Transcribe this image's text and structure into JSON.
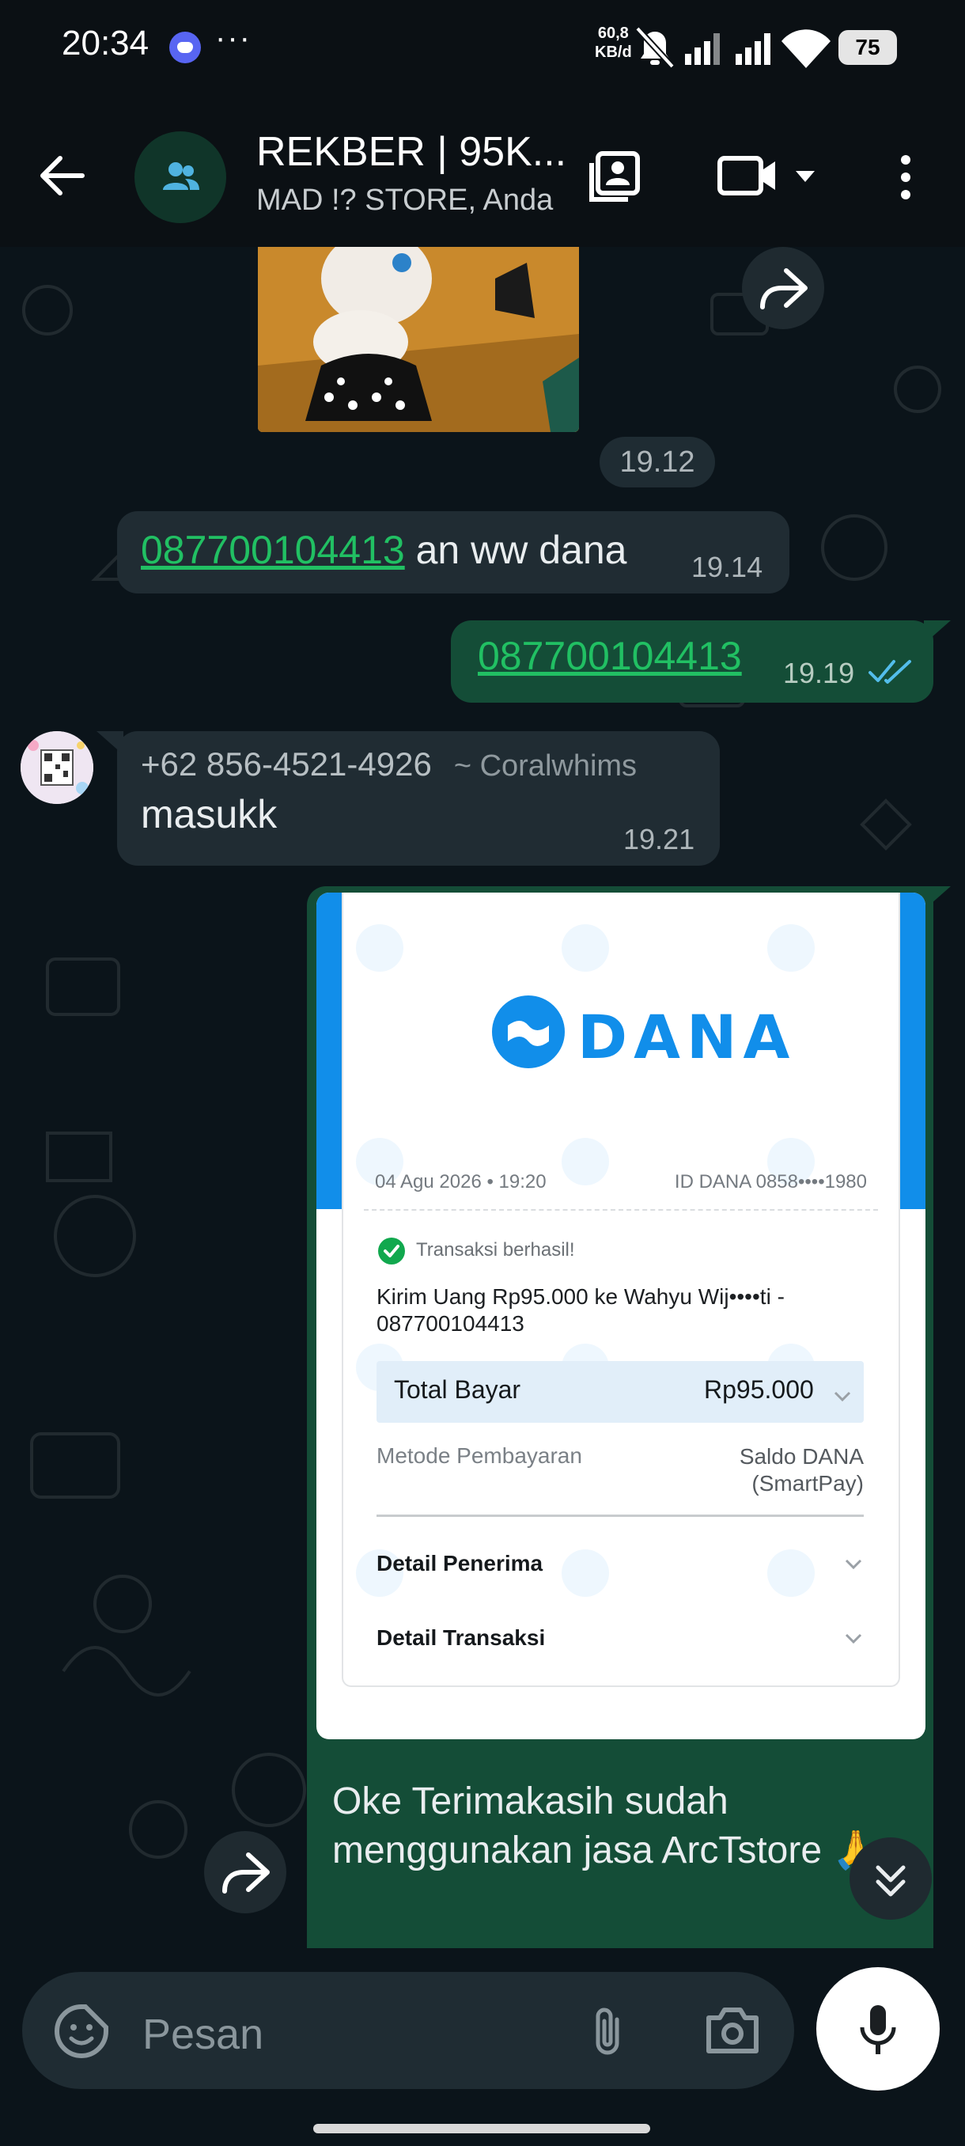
{
  "status_bar": {
    "time": "20:34",
    "more": "···",
    "net_speed_value": "60,8",
    "net_speed_unit": "KB/d",
    "battery": "75"
  },
  "header": {
    "title": "REKBER | 95K...",
    "subtitle": "MAD !? STORE, Anda"
  },
  "messages": {
    "sticker_time": "19.12",
    "msg1": {
      "link": "087700104413",
      "text": " an ww dana",
      "time": "19.14"
    },
    "msg2": {
      "link": "087700104413",
      "time": "19.19"
    },
    "msg3": {
      "sender_phone": "+62 856-4521-4926",
      "sender_name": "~ Coralwhims",
      "text": "masukk",
      "time": "19.21"
    }
  },
  "receipt": {
    "brand": "DANA",
    "date": "04 Agu 2026 • 19:20",
    "id": "ID DANA 0858••••1980",
    "status": "Transaksi berhasil!",
    "description": "Kirim Uang Rp95.000 ke Wahyu Wij••••ti - 087700104413",
    "total_label": "Total Bayar",
    "total_value": "Rp95.000",
    "method_label": "Metode Pembayaran",
    "method_value_1": "Saldo DANA",
    "method_value_2": "(SmartPay)",
    "detail_receiver": "Detail Penerima",
    "detail_transaction": "Detail Transaksi",
    "caption": "Oke Terimakasih sudah menggunakan jasa ArcTstore 🙏 ."
  },
  "input_bar": {
    "placeholder": "Pesan"
  },
  "colors": {
    "accent_green": "#21c063",
    "outgoing_bubble": "#144d37",
    "incoming_bubble": "#202c33",
    "dana_blue": "#118eea",
    "read_ticks": "#53bdeb"
  }
}
